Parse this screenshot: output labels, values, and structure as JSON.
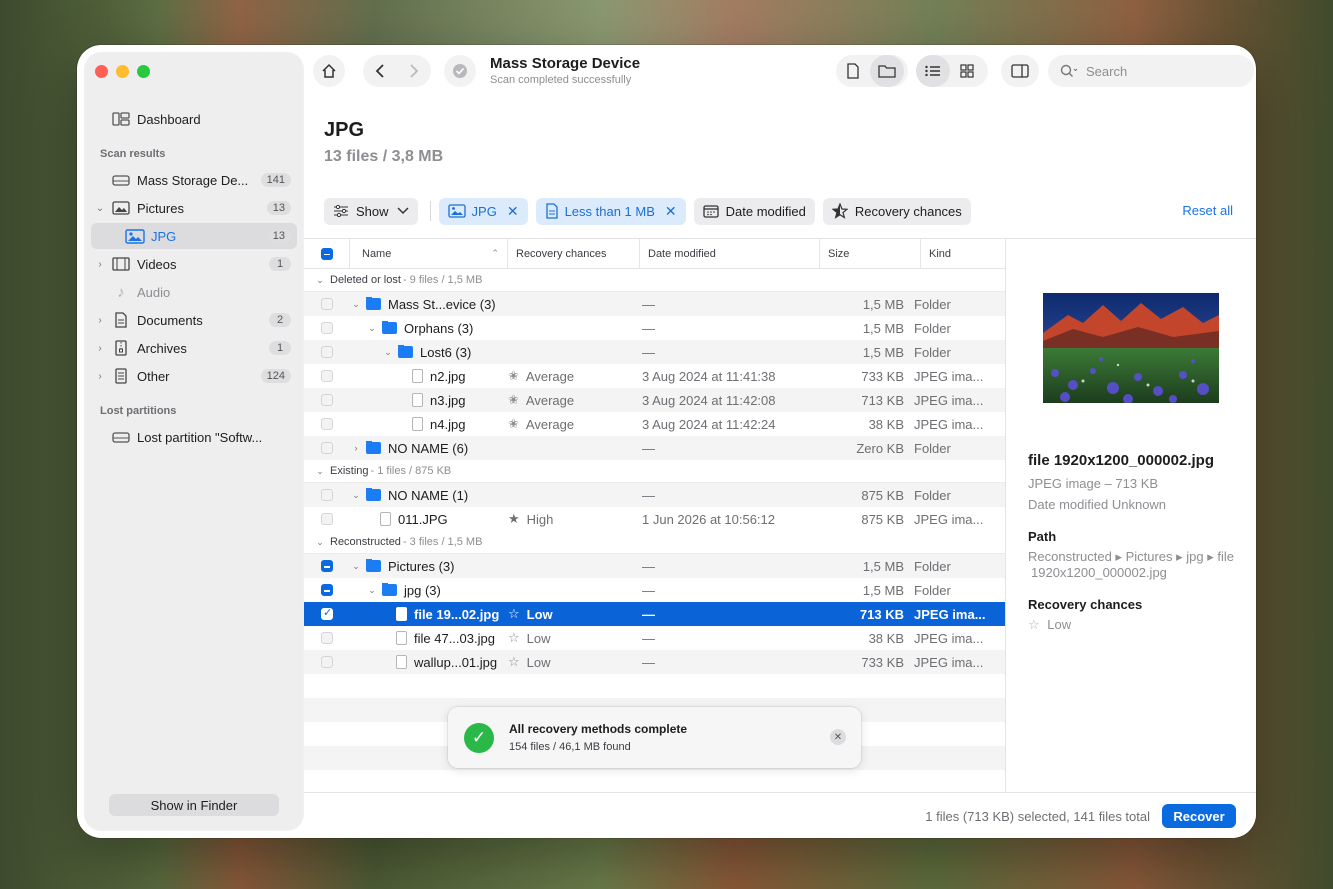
{
  "toolbar": {
    "title": "Mass Storage Device",
    "subtitle": "Scan completed successfully",
    "search_placeholder": "Search"
  },
  "sidebar": {
    "dashboard": "Dashboard",
    "scan_results_heading": "Scan results",
    "lost_partitions_heading": "Lost partitions",
    "items": [
      {
        "label": "Mass Storage De...",
        "count": "141"
      },
      {
        "label": "Pictures",
        "count": "13"
      },
      {
        "label": "JPG",
        "count": "13"
      },
      {
        "label": "Videos",
        "count": "1"
      },
      {
        "label": "Audio",
        "count": ""
      },
      {
        "label": "Documents",
        "count": "2"
      },
      {
        "label": "Archives",
        "count": "1"
      },
      {
        "label": "Other",
        "count": "124"
      }
    ],
    "lost_partition": "Lost partition \"Softw...",
    "show_in_finder": "Show in Finder"
  },
  "header": {
    "title": "JPG",
    "subtitle": "13 files / 3,8 MB"
  },
  "filters": {
    "show": "Show",
    "jpg": "JPG",
    "size": "Less than 1 MB",
    "date": "Date modified",
    "recovery": "Recovery chances",
    "reset": "Reset all"
  },
  "table": {
    "columns": [
      "Name",
      "Recovery chances",
      "Date modified",
      "Size",
      "Kind"
    ],
    "groups": [
      {
        "title": "Deleted or lost",
        "meta": "- 9 files / 1,5 MB"
      },
      {
        "title": "Existing",
        "meta": "- 1 files / 875 KB"
      },
      {
        "title": "Reconstructed",
        "meta": "- 3 files / 1,5 MB"
      }
    ],
    "rows": [
      {
        "name": "Mass St...evice (3)",
        "rc": "",
        "date": "—",
        "size": "1,5 MB",
        "kind": "Folder"
      },
      {
        "name": "Orphans (3)",
        "rc": "",
        "date": "—",
        "size": "1,5 MB",
        "kind": "Folder"
      },
      {
        "name": "Lost6 (3)",
        "rc": "",
        "date": "—",
        "size": "1,5 MB",
        "kind": "Folder"
      },
      {
        "name": "n2.jpg",
        "rc": "Average",
        "date": "3 Aug 2024 at 11:41:38",
        "size": "733 KB",
        "kind": "JPEG ima..."
      },
      {
        "name": "n3.jpg",
        "rc": "Average",
        "date": "3 Aug 2024 at 11:42:08",
        "size": "713 KB",
        "kind": "JPEG ima..."
      },
      {
        "name": "n4.jpg",
        "rc": "Average",
        "date": "3 Aug 2024 at 11:42:24",
        "size": "38 KB",
        "kind": "JPEG ima..."
      },
      {
        "name": "NO NAME (6)",
        "rc": "",
        "date": "—",
        "size": "Zero KB",
        "kind": "Folder"
      },
      {
        "name": "NO NAME (1)",
        "rc": "",
        "date": "—",
        "size": "875 KB",
        "kind": "Folder"
      },
      {
        "name": "011.JPG",
        "rc": "High",
        "date": "1 Jun 2026 at 10:56:12",
        "size": "875 KB",
        "kind": "JPEG ima..."
      },
      {
        "name": "Pictures (3)",
        "rc": "",
        "date": "—",
        "size": "1,5 MB",
        "kind": "Folder"
      },
      {
        "name": "jpg (3)",
        "rc": "",
        "date": "—",
        "size": "1,5 MB",
        "kind": "Folder"
      },
      {
        "name": "file 19...02.jpg",
        "rc": "Low",
        "date": "—",
        "size": "713 KB",
        "kind": "JPEG ima..."
      },
      {
        "name": "file 47...03.jpg",
        "rc": "Low",
        "date": "—",
        "size": "38 KB",
        "kind": "JPEG ima..."
      },
      {
        "name": "wallup...01.jpg",
        "rc": "Low",
        "date": "—",
        "size": "733 KB",
        "kind": "JPEG ima..."
      }
    ]
  },
  "preview": {
    "filename": "file 1920x1200_000002.jpg",
    "type": "JPEG image – 713 KB",
    "date_label": "Date modified",
    "date_value": "Unknown",
    "path_heading": "Path",
    "path_line1": "Reconstructed ▸ Pictures ▸ jpg ▸ file",
    "path_line2": "1920x1200_000002.jpg",
    "recovery_heading": "Recovery chances",
    "recovery_value": "Low"
  },
  "toast": {
    "title": "All recovery methods complete",
    "subtitle": "154 files / 46,1 MB found"
  },
  "footer": {
    "status": "1 files (713 KB) selected, 141 files total",
    "recover": "Recover"
  }
}
